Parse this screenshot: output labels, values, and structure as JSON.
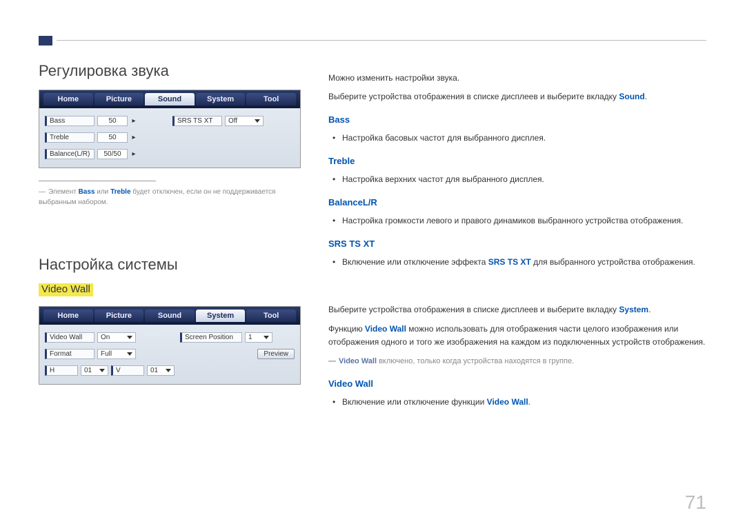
{
  "page_number": "71",
  "section1": {
    "title": "Регулировка звука",
    "screenshot": {
      "tabs": [
        "Home",
        "Picture",
        "Sound",
        "System",
        "Tool"
      ],
      "active_tab": "Sound",
      "left_rows": [
        {
          "label": "Bass",
          "value": "50",
          "arrow": true
        },
        {
          "label": "Treble",
          "value": "50",
          "arrow": true
        },
        {
          "label": "Balance(L/R)",
          "value": "50/50",
          "arrow": true
        }
      ],
      "right_rows": [
        {
          "label": "SRS TS XT",
          "select": "Off"
        }
      ]
    },
    "footnote_pre": "Элемент ",
    "footnote_b1": "Bass",
    "footnote_mid": " или ",
    "footnote_b2": "Treble",
    "footnote_post": " будет отключен, если он не поддерживается выбранным набором.",
    "intro1": "Можно изменить настройки звука.",
    "intro2_pre": "Выберите устройства отображения в списке дисплеев и выберите вкладку ",
    "intro2_link": "Sound",
    "intro2_post": ".",
    "items": [
      {
        "h": "Bass",
        "li": "Настройка басовых частот для выбранного дисплея."
      },
      {
        "h": "Treble",
        "li": "Настройка верхних частот для выбранного дисплея."
      },
      {
        "h": "BalanceL/R",
        "li": "Настройка громкости левого и правого динамиков выбранного устройства отображения."
      },
      {
        "h": "SRS TS XT",
        "li_pre": "Включение или отключение эффекта ",
        "li_link": "SRS TS XT",
        "li_post": " для выбранного устройства отображения."
      }
    ]
  },
  "section2": {
    "title": "Настройка системы",
    "highlight": "Video Wall",
    "screenshot": {
      "tabs": [
        "Home",
        "Picture",
        "Sound",
        "System",
        "Tool"
      ],
      "active_tab": "System",
      "left_rows": [
        {
          "label": "Video Wall",
          "select": "On"
        },
        {
          "label": "Format",
          "select": "Full"
        }
      ],
      "hv_row": {
        "h_label": "H",
        "h_val": "01",
        "v_label": "V",
        "v_val": "01"
      },
      "right_rows": [
        {
          "label": "Screen Position",
          "select": "1"
        },
        {
          "button": "Preview"
        }
      ]
    },
    "intro_pre": "Выберите устройства отображения в списке дисплеев и выберите вкладку ",
    "intro_link": "System",
    "intro_post": ".",
    "p2_pre": "Функцию ",
    "p2_link": "Video Wall",
    "p2_post": " можно использовать для отображения части целого изображения или отображения одного и того же изображения на каждом из подключенных устройств отображения.",
    "note_b": "Video Wall",
    "note_post": " включено, только когда устройства находятся в группе.",
    "item_h": "Video Wall",
    "item_li_pre": "Включение или отключение функции ",
    "item_li_link": "Video Wall",
    "item_li_post": "."
  }
}
